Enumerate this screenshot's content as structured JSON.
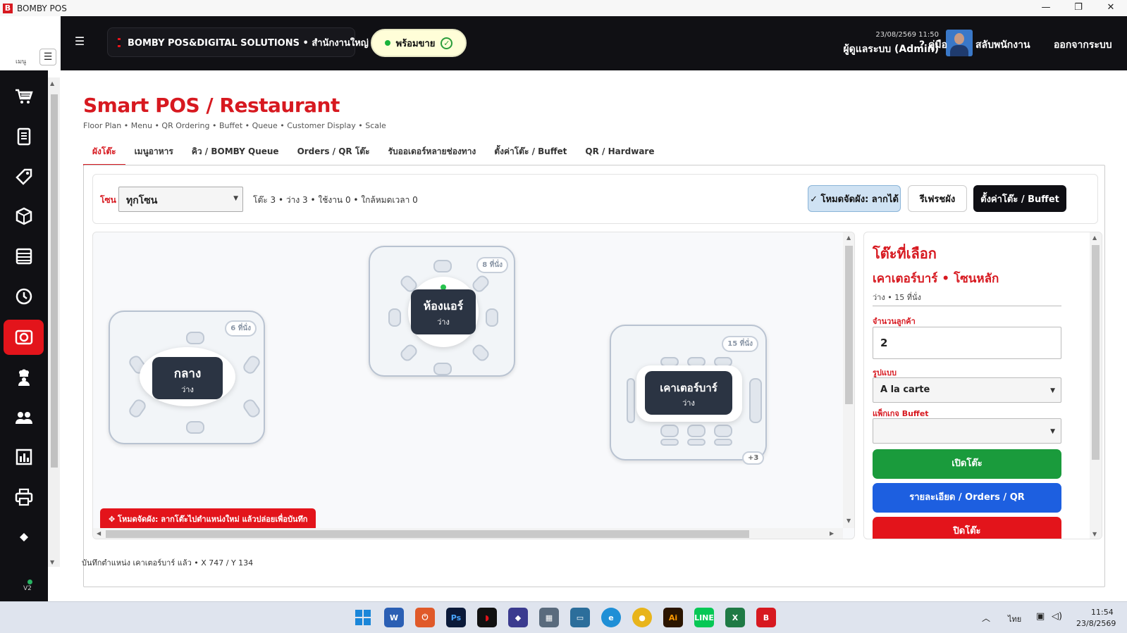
{
  "window": {
    "title": "BOMBY POS",
    "logo_letter": "B",
    "minimize": "—",
    "restore": "❐",
    "close": "✕"
  },
  "sidebar": {
    "menu_label": "เมนู",
    "toggle_glyph": "☰",
    "version": "V2",
    "items": [
      {
        "icon": "cart-icon",
        "active": false
      },
      {
        "icon": "receipt-icon",
        "active": false
      },
      {
        "icon": "tag-icon",
        "active": false
      },
      {
        "icon": "box-icon",
        "active": false
      },
      {
        "icon": "list-icon",
        "active": false
      },
      {
        "icon": "clock-icon",
        "active": false
      },
      {
        "icon": "dining-icon",
        "active": true
      },
      {
        "icon": "chef-icon",
        "active": false
      },
      {
        "icon": "users-icon",
        "active": false
      },
      {
        "icon": "report-icon",
        "active": false
      },
      {
        "icon": "printer-icon",
        "active": false
      },
      {
        "icon": "diamond-icon",
        "active": false
      }
    ]
  },
  "header": {
    "menu_glyph": "☰",
    "brand": "BOMBY POS&DIGITAL SOLUTIONS • สำนักงานใหญ่",
    "status": "พร้อมขาย",
    "status_check": "✓",
    "datetime": "23/08/2569 11:50",
    "user": "ผู้ดูแลระบบ (Admin)",
    "help": "? คู่มือ",
    "switch_staff": "สลับพนักงาน",
    "logout": "ออกจากระบบ"
  },
  "page": {
    "title": "Smart POS / Restaurant",
    "subtitle": "Floor Plan • Menu • QR Ordering • Buffet • Queue • Customer Display • Scale",
    "tabs": [
      {
        "label": "ผังโต๊ะ",
        "active": true
      },
      {
        "label": "เมนูอาหาร",
        "active": false
      },
      {
        "label": "คิว / BOMBY Queue",
        "active": false
      },
      {
        "label": "Orders / QR โต๊ะ",
        "active": false
      },
      {
        "label": "รับออเดอร์หลายช่องทาง",
        "active": false
      },
      {
        "label": "ตั้งค่าโต๊ะ / Buffet",
        "active": false
      },
      {
        "label": "QR / Hardware",
        "active": false
      }
    ]
  },
  "zone": {
    "label": "โซน",
    "selected": "ทุกโซน",
    "stats": "โต๊ะ 3 • ว่าง 3 • ใช้งาน 0 • ใกล้หมดเวลา 0",
    "mode_button": "✓ โหมดจัดผัง: ลากได้",
    "refresh_button": "รีเฟรชผัง",
    "settings_button": "ตั้งค่าโต๊ะ / Buffet"
  },
  "tables": [
    {
      "name": "กลาง",
      "status": "ว่าง",
      "seats": "6 ที่นั่ง"
    },
    {
      "name": "ห้องแอร์",
      "status": "ว่าง",
      "seats": "8 ที่นั่ง"
    },
    {
      "name": "เคาเตอร์บาร์",
      "status": "ว่าง",
      "seats": "15 ที่นั่ง",
      "extra": "+3"
    }
  ],
  "mode_banner": "✥ โหมดจัดผัง: ลากโต๊ะไปตำแหน่งใหม่ แล้วปล่อยเพื่อบันทึก",
  "selected": {
    "heading": "โต๊ะที่เลือก",
    "table": "เคาเตอร์บาร์ • โซนหลัก",
    "info": "ว่าง • 15 ที่นั่ง",
    "customers_label": "จำนวนลูกค้า",
    "customers_value": "2",
    "style_label": "รูปแบบ",
    "style_value": "A la carte",
    "package_label": "แพ็กเกจ Buffet",
    "package_value": "",
    "open_button": "เปิดโต๊ะ",
    "details_button": "รายละเอียด / Orders / QR",
    "close_button": "ปิดโต๊ะ"
  },
  "saved_message": "บันทึกตำแหน่ง เคาเตอร์บาร์ แล้ว • X 747 / Y 134",
  "taskbar": {
    "apps": [
      "windows-start-icon",
      "word-icon",
      "power-icon",
      "photoshop-icon",
      "app-icon",
      "shield-app-icon",
      "calculator-icon",
      "screen-icon",
      "edge-icon",
      "chrome-icon",
      "illustrator-icon",
      "line-icon",
      "excel-icon",
      "bomby-icon"
    ],
    "lang": "ไทย",
    "time": "11:54",
    "date": "23/8/2569"
  },
  "colors": {
    "brand_red": "#d71920",
    "green": "#1a9b3c",
    "blue": "#1d5fe0",
    "dark": "#101014"
  }
}
